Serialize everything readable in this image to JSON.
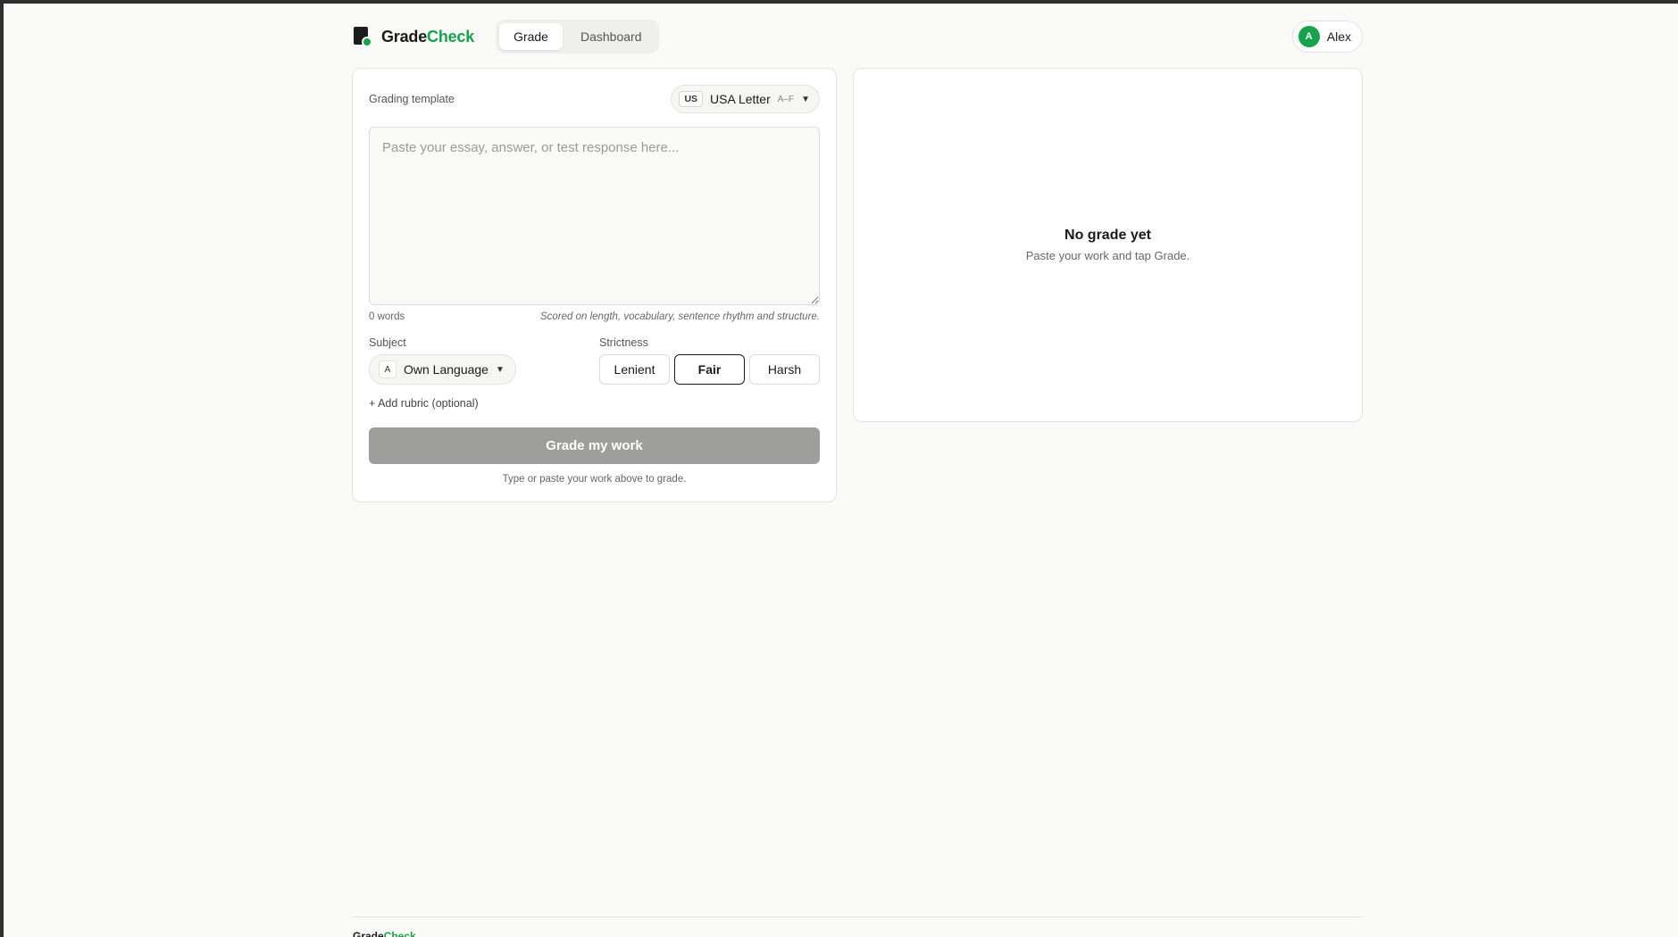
{
  "header": {
    "brand_part1": "Grade",
    "brand_part2": "Check",
    "nav": [
      {
        "label": "Grade",
        "active": true
      },
      {
        "label": "Dashboard",
        "active": false
      }
    ],
    "user": {
      "initial": "A",
      "name": "Alex"
    }
  },
  "grader": {
    "template_label": "Grading template",
    "template": {
      "flag": "US",
      "name": "USA Letter",
      "range": "A–F"
    },
    "essay_placeholder": "Paste your essay, answer, or test response here...",
    "word_count": "0 words",
    "score_note": "Scored on length, vocabulary, sentence rhythm and structure.",
    "subject_label": "Subject",
    "subject": {
      "icon": "A",
      "name": "Own Language"
    },
    "strictness_label": "Strictness",
    "strictness_options": [
      "Lenient",
      "Fair",
      "Harsh"
    ],
    "strictness_selected": "Fair",
    "add_rubric": "+ Add rubric (optional)",
    "grade_button": "Grade my work",
    "grade_hint": "Type or paste your work above to grade."
  },
  "result": {
    "empty_title": "No grade yet",
    "empty_subtitle": "Paste your work and tap Grade."
  },
  "colors": {
    "accent": "#16a34a",
    "disabled_button": "#9e9e9c",
    "background": "#fafaf8"
  }
}
